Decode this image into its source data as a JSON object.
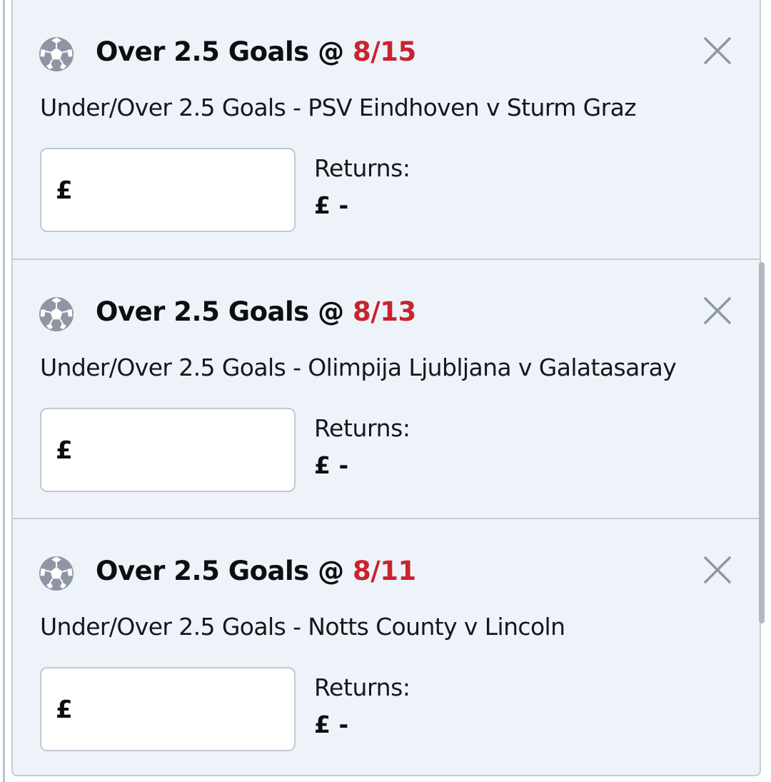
{
  "colors": {
    "panel_background": "#eef3f9",
    "border": "#c3ccd9",
    "odds_red": "#c8242f",
    "icon_grey": "#8e96a6"
  },
  "icons": {
    "sport": "football-icon",
    "remove": "close-icon"
  },
  "bets": [
    {
      "selection": "Over 2.5 Goals @",
      "odds": "8/15",
      "market": "Under/Over 2.5 Goals - PSV Eindhoven v Sturm Graz",
      "stake_currency": "£",
      "stake_value": "",
      "returns_label": "Returns:",
      "returns_value": "£ -"
    },
    {
      "selection": "Over 2.5 Goals @",
      "odds": "8/13",
      "market": "Under/Over 2.5 Goals - Olimpija Ljubljana v Galatasaray",
      "stake_currency": "£",
      "stake_value": "",
      "returns_label": "Returns:",
      "returns_value": "£ -"
    },
    {
      "selection": "Over 2.5 Goals @",
      "odds": "8/11",
      "market": "Under/Over 2.5 Goals - Notts County v Lincoln",
      "stake_currency": "£",
      "stake_value": "",
      "returns_label": "Returns:",
      "returns_value": "£ -"
    }
  ]
}
